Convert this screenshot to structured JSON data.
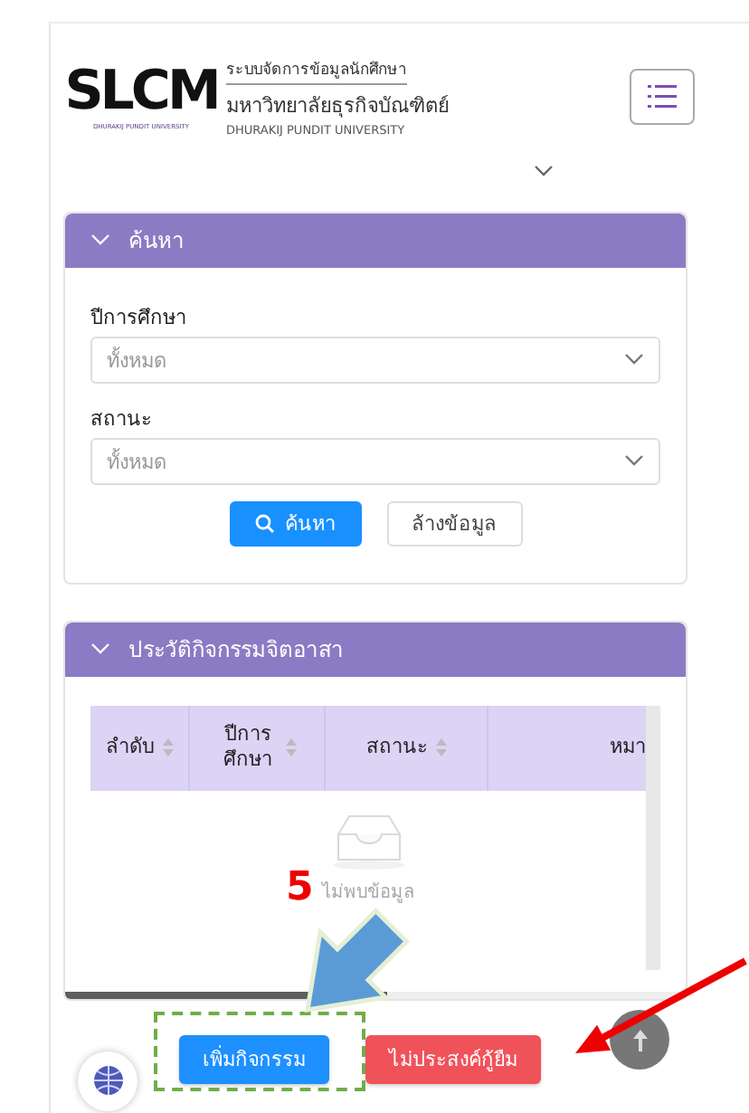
{
  "header": {
    "logo": "SLCM",
    "logo_caption": "DHURAKIJ PUNDIT UNIVERSITY",
    "system_name": "ระบบจัดการข้อมูลนักศึกษา",
    "university_th": "มหาวิทยาลัยธุรกิจบัณฑิตย์",
    "university_en": "DHURAKIJ PUNDIT UNIVERSITY",
    "expanded": false
  },
  "search_panel": {
    "title": "ค้นหา",
    "expanded": true,
    "fields": [
      {
        "label": "ปีการศึกษา",
        "placeholder": "ทั้งหมด"
      },
      {
        "label": "สถานะ",
        "placeholder": "ทั้งหมด"
      }
    ],
    "buttons": [
      {
        "label": "ค้นหา",
        "kind": "search"
      },
      {
        "label": "ล้างข้อมูล",
        "kind": "clear"
      }
    ]
  },
  "history_panel": {
    "title": "ประวัติกิจกรรมจิตอาสา",
    "expanded": true,
    "columns": [
      {
        "label": "ลำดับ",
        "sortable": true
      },
      {
        "label": "ปีการศึกษา",
        "sortable": true
      },
      {
        "label": "สถานะ",
        "sortable": true
      },
      {
        "label": "หมา",
        "sortable": false
      }
    ],
    "empty_text": "ไม่พบข้อมูล"
  },
  "actions": [
    {
      "label": "เพิ่มกิจกรรม",
      "kind": "primary"
    },
    {
      "label": "ไม่ประสงค์กู้ยืม",
      "kind": "danger"
    }
  ],
  "annotation": {
    "step": "5"
  }
}
